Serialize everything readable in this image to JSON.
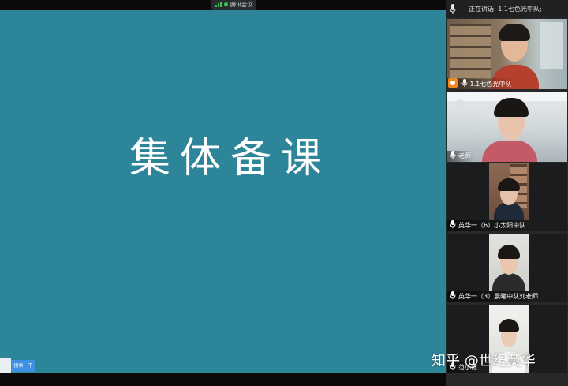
{
  "app": {
    "title": "腾讯会议"
  },
  "shared_screen": {
    "slide_title": "集体备课",
    "background": "#2c8599"
  },
  "search_button": {
    "label": "搜索一下"
  },
  "speaking": {
    "label": "正在讲话: 1.1七色光中队;"
  },
  "participants": [
    {
      "name": "1.1七色光中队",
      "is_host": true
    },
    {
      "name": "老师",
      "is_host": false
    },
    {
      "name": "英华一（6）小太阳中队",
      "is_host": false
    },
    {
      "name": "英华一（3）晨曦中队刘老师",
      "is_host": false
    },
    {
      "name": "范小霞",
      "is_host": false
    }
  ],
  "watermark": {
    "text": "知乎 @世纪英华"
  },
  "colors": {
    "accent_green": "#3ec05a",
    "host_badge": "#f08a1c",
    "search_blue": "#3f8fe2"
  },
  "icons": [
    "signal-icon",
    "status-dot-icon",
    "microphone-icon",
    "host-badge-icon"
  ]
}
